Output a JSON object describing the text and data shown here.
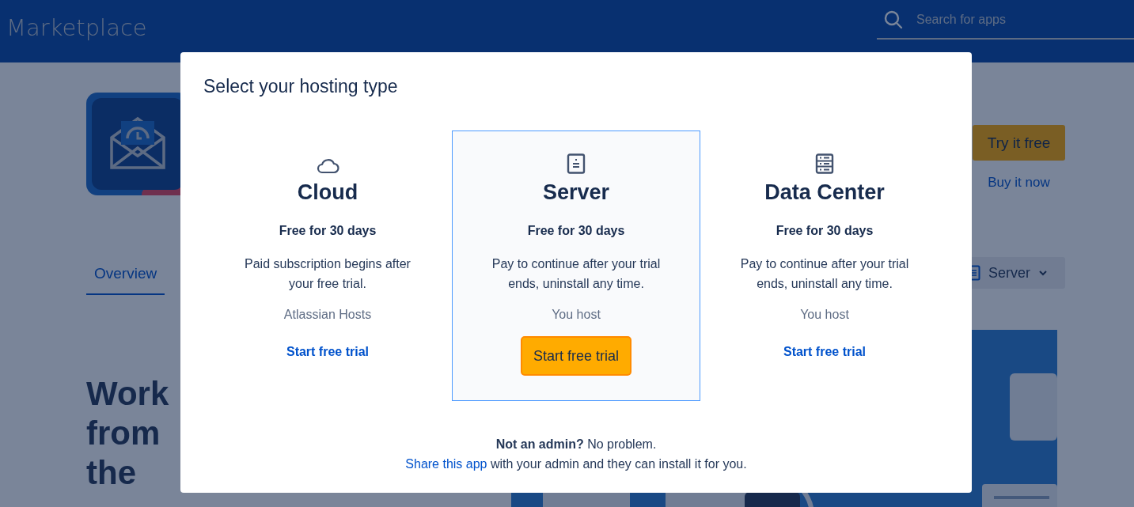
{
  "header": {
    "logo": "Marketplace",
    "search": {
      "placeholder": "Search for apps"
    }
  },
  "app": {
    "try_button": "Try it free",
    "buy_link": "Buy it now"
  },
  "tabs": [
    {
      "label": "Overview",
      "selected": true
    }
  ],
  "hosting_select": {
    "label": "Server"
  },
  "headline_lines": [
    "Work",
    "from",
    "the"
  ],
  "modal": {
    "title": "Select your hosting type",
    "options": [
      {
        "kind": "cloud",
        "name": "Cloud",
        "trial": "Free for 30 days",
        "description": "Paid subscription begins after your free trial.",
        "hosting": "Atlassian Hosts",
        "action": "Start free trial",
        "selected": false
      },
      {
        "kind": "server",
        "name": "Server",
        "trial": "Free for 30 days",
        "description": "Pay to continue after your trial ends, uninstall any time.",
        "hosting": "You host",
        "action": "Start free trial",
        "selected": true
      },
      {
        "kind": "datacenter",
        "name": "Data Center",
        "trial": "Free for 30 days",
        "description": "Pay to continue after your trial ends, uninstall any time.",
        "hosting": "You host",
        "action": "Start free trial",
        "selected": false
      }
    ],
    "footer": {
      "note": "**Not an admin?** No problem.",
      "link": "Share this app",
      "rest": " with your admin and they can install it for you."
    }
  }
}
